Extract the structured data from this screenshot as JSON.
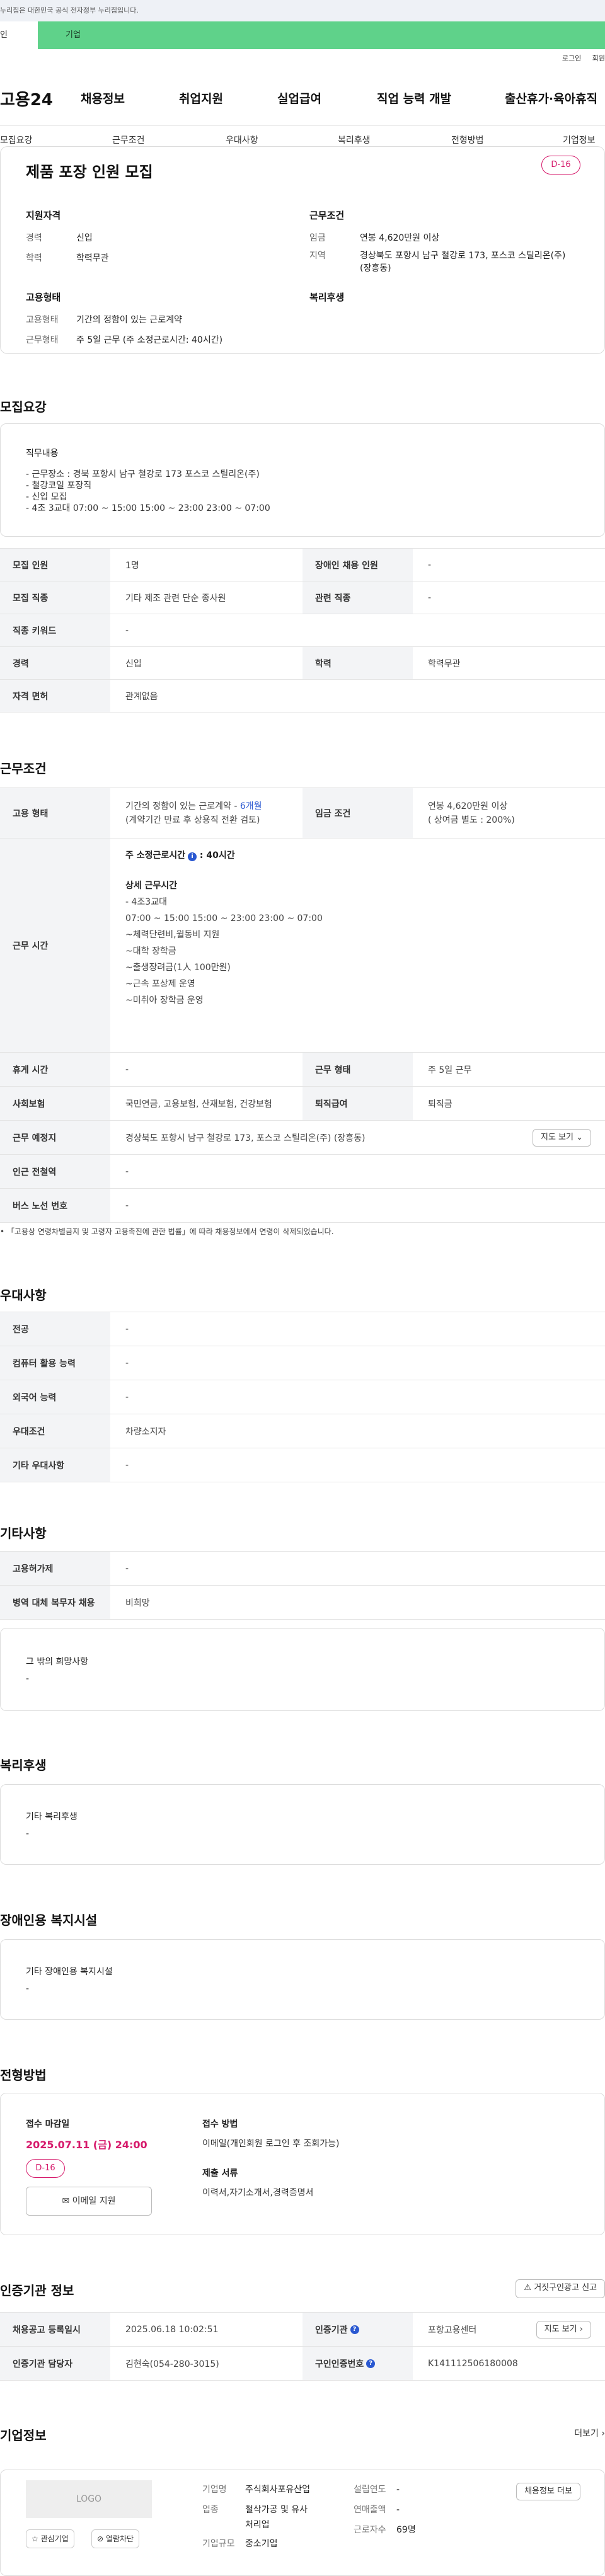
{
  "notice": "누리집은 대한민국 공식 전자정부 누리집입니다.",
  "user_tabs": {
    "individual": "인",
    "business": "기업"
  },
  "top_links": {
    "login": "로그인",
    "signup": "회원"
  },
  "header": {
    "logo": "고용24",
    "nav": [
      "채용정보",
      "취업지원",
      "실업급여",
      "직업 능력 개발",
      "출산휴가·육아휴직"
    ]
  },
  "tabs": [
    "모집요강",
    "근무조건",
    "우대사항",
    "복리후생",
    "전형방법",
    "기업정보"
  ],
  "summary": {
    "title": "제품 포장 인원 모집",
    "dday": "D-16",
    "qual_title": "지원자격",
    "qual": [
      {
        "k": "경력",
        "v": "신입"
      },
      {
        "k": "학력",
        "v": "학력무관"
      }
    ],
    "cond_title": "근무조건",
    "cond": [
      {
        "k": "임금",
        "v": "연봉 4,620만원 이상"
      },
      {
        "k": "지역",
        "v": "경상북도 포항시 남구 철강로 173, 포스코 스틸리온(주)"
      },
      {
        "k": "",
        "v": "(장흥동)"
      }
    ],
    "emp_title": "고용형태",
    "emp": [
      {
        "k": "고용형태",
        "v": "기간의 정함이 있는 근로계약"
      },
      {
        "k": "근무형태",
        "v": "주 5일 근무 (주 소정근로시간: 40시간)"
      }
    ],
    "welfare_title": "복리후생"
  },
  "recruit": {
    "section": "모집요강",
    "job_h": "직무내용",
    "job_lines": [
      "- 근무장소 : 경북 포항시 남구 철강로 173 포스코 스틸리온(주)",
      "- 철강코일 포장직",
      "- 신입 모집",
      "- 4조 3교대   07:00 ~ 15:00  15:00 ~ 23:00  23:00 ~ 07:00"
    ],
    "rows": [
      {
        "k1": "모집 인원",
        "v1": "1명",
        "k2": "장애인 채용 인원",
        "v2": "-"
      },
      {
        "k1": "모집 직종",
        "v1": "기타 제조 관련 단순 종사원",
        "k2": "관련 직종",
        "v2": "-"
      },
      {
        "k1": "직종 키워드",
        "v1": "-"
      },
      {
        "k1": "경력",
        "v1": "신입",
        "k2": "학력",
        "v2": "학력무관"
      },
      {
        "k1": "자격 면허",
        "v1": "관계없음"
      }
    ]
  },
  "conditions": {
    "section": "근무조건",
    "emp_k": "고용 형태",
    "emp_v1": "기간의 정함이 있는 근로계약 - ",
    "emp_v1b": "6개월",
    "emp_v2": "(계약기간 만료 후 상용직 전환 검토)",
    "wage_k": "임금 조건",
    "wage_v1": "연봉 4,620만원 이상",
    "wage_v2": "( 상여금 별도 : 200%)",
    "time_k": "근무 시간",
    "time_h": "주 소정근로시간",
    "time_h2": ": 40시간",
    "detail_h": "상세 근무시간",
    "detail_lines": [
      "- 4조3교대",
      "07:00 ~ 15:00  15:00 ~ 23:00  23:00 ~ 07:00",
      "~체력단련비,월동비 지원",
      "~대학 장학금",
      "~출생장려금(1人 100만원)",
      "~근속 포상제 운영",
      "~미취아 장학금 운영"
    ],
    "rows": [
      {
        "k1": "휴게 시간",
        "v1": "-",
        "k2": "근무 형태",
        "v2": "주 5일 근무"
      },
      {
        "k1": "사회보험",
        "v1": "국민연금, 고용보험, 산재보험, 건강보험",
        "k2": "퇴직급여",
        "v2": "퇴직금"
      },
      {
        "k1": "근무 예정지",
        "v1": "경상북도 포항시 남구 철강로 173, 포스코 스틸리온(주) (장흥동)",
        "btn": "지도 보기"
      },
      {
        "k1": "인근 전철역",
        "v1": "-"
      },
      {
        "k1": "버스 노선 번호",
        "v1": "-"
      }
    ],
    "note": "「고용상 연령차별금지 및 고령자 고용촉진에 관한 법률」에 따라 채용정보에서 연령이 삭제되었습니다."
  },
  "preference": {
    "section": "우대사항",
    "rows": [
      {
        "k": "전공",
        "v": "-"
      },
      {
        "k": "컴퓨터 활용 능력",
        "v": "-"
      },
      {
        "k": "외국어 능력",
        "v": "-"
      },
      {
        "k": "우대조건",
        "v": "차량소지자"
      },
      {
        "k": "기타 우대사항",
        "v": "-"
      }
    ]
  },
  "etc": {
    "section": "기타사항",
    "rows": [
      {
        "k": "고용허가제",
        "v": "-"
      },
      {
        "k": "병역 대체 복무자 채용",
        "v": "비희망"
      }
    ],
    "box_h": "그 밖의 희망사항",
    "box_v": "-"
  },
  "welfare": {
    "section": "복리후생",
    "box_h": "기타 복리후생",
    "box_v": "-"
  },
  "disability": {
    "section": "장애인용 복지시설",
    "box_h": "기타 장애인용 복지시설",
    "box_v": "-"
  },
  "process": {
    "section": "전형방법",
    "deadline_h": "접수 마감일",
    "deadline": "2025.07.11 (금) 24:00",
    "dday": "D-16",
    "apply_btn": "이메일 지원",
    "method_h": "접수 방법",
    "method_v": "이메일(개인회원 로그인 후 조회가능)",
    "docs_h": "제출 서류",
    "docs_v": "이력서,자기소개서,경력증명서"
  },
  "agency": {
    "section": "인증기관 정보",
    "btn": "거짓구인광고 신고",
    "rows": [
      {
        "k1": "채용공고 등록일시",
        "v1": "2025.06.18 10:02:51",
        "k2": "인증기관",
        "v2": "포항고용센터",
        "btn": "지도 보기"
      },
      {
        "k1": "인증기관 담당자",
        "v1": "김현숙(054-280-3015)",
        "k2": "구인인증번호",
        "v2": "K141112506180008"
      }
    ]
  },
  "company": {
    "section": "기업정보",
    "more": "더보기",
    "logo": "LOGO",
    "fav": "관심기업",
    "block": "열람차단",
    "info": [
      {
        "k": "기업명",
        "v": "주식회사포유산업"
      },
      {
        "k": "업종",
        "v": "철삭가공 및 유사"
      },
      {
        "k": "",
        "v": "처리업"
      },
      {
        "k": "기업규모",
        "v": "중소기업"
      }
    ],
    "info2": [
      {
        "k": "설립연도",
        "v": "-"
      },
      {
        "k": "연매출액",
        "v": "-"
      },
      {
        "k": "근로자수",
        "v": "69명"
      }
    ],
    "jobs_btn": "채용정보 더보"
  }
}
